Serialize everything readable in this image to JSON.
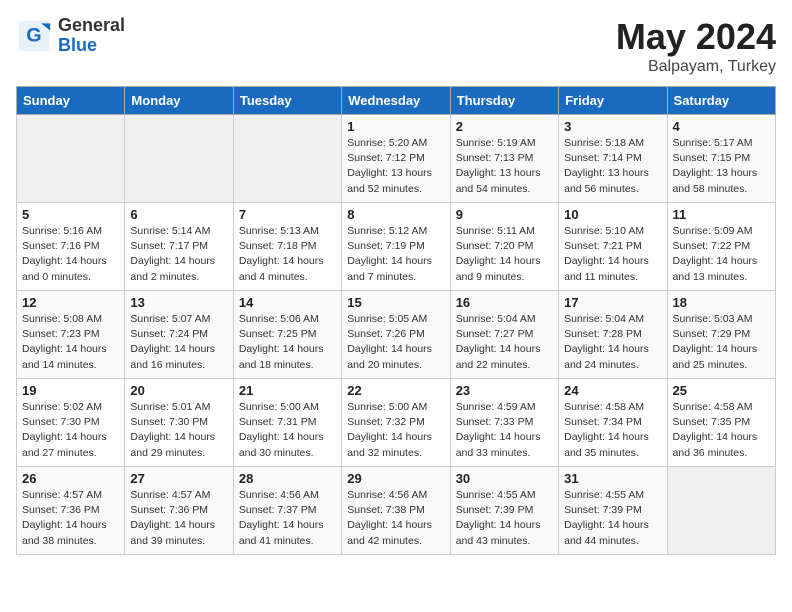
{
  "header": {
    "logo_general": "General",
    "logo_blue": "Blue",
    "month_title": "May 2024",
    "location": "Balpayam, Turkey"
  },
  "days_of_week": [
    "Sunday",
    "Monday",
    "Tuesday",
    "Wednesday",
    "Thursday",
    "Friday",
    "Saturday"
  ],
  "weeks": [
    [
      {
        "day": "",
        "info": ""
      },
      {
        "day": "",
        "info": ""
      },
      {
        "day": "",
        "info": ""
      },
      {
        "day": "1",
        "info": "Sunrise: 5:20 AM\nSunset: 7:12 PM\nDaylight: 13 hours and 52 minutes."
      },
      {
        "day": "2",
        "info": "Sunrise: 5:19 AM\nSunset: 7:13 PM\nDaylight: 13 hours and 54 minutes."
      },
      {
        "day": "3",
        "info": "Sunrise: 5:18 AM\nSunset: 7:14 PM\nDaylight: 13 hours and 56 minutes."
      },
      {
        "day": "4",
        "info": "Sunrise: 5:17 AM\nSunset: 7:15 PM\nDaylight: 13 hours and 58 minutes."
      }
    ],
    [
      {
        "day": "5",
        "info": "Sunrise: 5:16 AM\nSunset: 7:16 PM\nDaylight: 14 hours and 0 minutes."
      },
      {
        "day": "6",
        "info": "Sunrise: 5:14 AM\nSunset: 7:17 PM\nDaylight: 14 hours and 2 minutes."
      },
      {
        "day": "7",
        "info": "Sunrise: 5:13 AM\nSunset: 7:18 PM\nDaylight: 14 hours and 4 minutes."
      },
      {
        "day": "8",
        "info": "Sunrise: 5:12 AM\nSunset: 7:19 PM\nDaylight: 14 hours and 7 minutes."
      },
      {
        "day": "9",
        "info": "Sunrise: 5:11 AM\nSunset: 7:20 PM\nDaylight: 14 hours and 9 minutes."
      },
      {
        "day": "10",
        "info": "Sunrise: 5:10 AM\nSunset: 7:21 PM\nDaylight: 14 hours and 11 minutes."
      },
      {
        "day": "11",
        "info": "Sunrise: 5:09 AM\nSunset: 7:22 PM\nDaylight: 14 hours and 13 minutes."
      }
    ],
    [
      {
        "day": "12",
        "info": "Sunrise: 5:08 AM\nSunset: 7:23 PM\nDaylight: 14 hours and 14 minutes."
      },
      {
        "day": "13",
        "info": "Sunrise: 5:07 AM\nSunset: 7:24 PM\nDaylight: 14 hours and 16 minutes."
      },
      {
        "day": "14",
        "info": "Sunrise: 5:06 AM\nSunset: 7:25 PM\nDaylight: 14 hours and 18 minutes."
      },
      {
        "day": "15",
        "info": "Sunrise: 5:05 AM\nSunset: 7:26 PM\nDaylight: 14 hours and 20 minutes."
      },
      {
        "day": "16",
        "info": "Sunrise: 5:04 AM\nSunset: 7:27 PM\nDaylight: 14 hours and 22 minutes."
      },
      {
        "day": "17",
        "info": "Sunrise: 5:04 AM\nSunset: 7:28 PM\nDaylight: 14 hours and 24 minutes."
      },
      {
        "day": "18",
        "info": "Sunrise: 5:03 AM\nSunset: 7:29 PM\nDaylight: 14 hours and 25 minutes."
      }
    ],
    [
      {
        "day": "19",
        "info": "Sunrise: 5:02 AM\nSunset: 7:30 PM\nDaylight: 14 hours and 27 minutes."
      },
      {
        "day": "20",
        "info": "Sunrise: 5:01 AM\nSunset: 7:30 PM\nDaylight: 14 hours and 29 minutes."
      },
      {
        "day": "21",
        "info": "Sunrise: 5:00 AM\nSunset: 7:31 PM\nDaylight: 14 hours and 30 minutes."
      },
      {
        "day": "22",
        "info": "Sunrise: 5:00 AM\nSunset: 7:32 PM\nDaylight: 14 hours and 32 minutes."
      },
      {
        "day": "23",
        "info": "Sunrise: 4:59 AM\nSunset: 7:33 PM\nDaylight: 14 hours and 33 minutes."
      },
      {
        "day": "24",
        "info": "Sunrise: 4:58 AM\nSunset: 7:34 PM\nDaylight: 14 hours and 35 minutes."
      },
      {
        "day": "25",
        "info": "Sunrise: 4:58 AM\nSunset: 7:35 PM\nDaylight: 14 hours and 36 minutes."
      }
    ],
    [
      {
        "day": "26",
        "info": "Sunrise: 4:57 AM\nSunset: 7:36 PM\nDaylight: 14 hours and 38 minutes."
      },
      {
        "day": "27",
        "info": "Sunrise: 4:57 AM\nSunset: 7:36 PM\nDaylight: 14 hours and 39 minutes."
      },
      {
        "day": "28",
        "info": "Sunrise: 4:56 AM\nSunset: 7:37 PM\nDaylight: 14 hours and 41 minutes."
      },
      {
        "day": "29",
        "info": "Sunrise: 4:56 AM\nSunset: 7:38 PM\nDaylight: 14 hours and 42 minutes."
      },
      {
        "day": "30",
        "info": "Sunrise: 4:55 AM\nSunset: 7:39 PM\nDaylight: 14 hours and 43 minutes."
      },
      {
        "day": "31",
        "info": "Sunrise: 4:55 AM\nSunset: 7:39 PM\nDaylight: 14 hours and 44 minutes."
      },
      {
        "day": "",
        "info": ""
      }
    ]
  ]
}
